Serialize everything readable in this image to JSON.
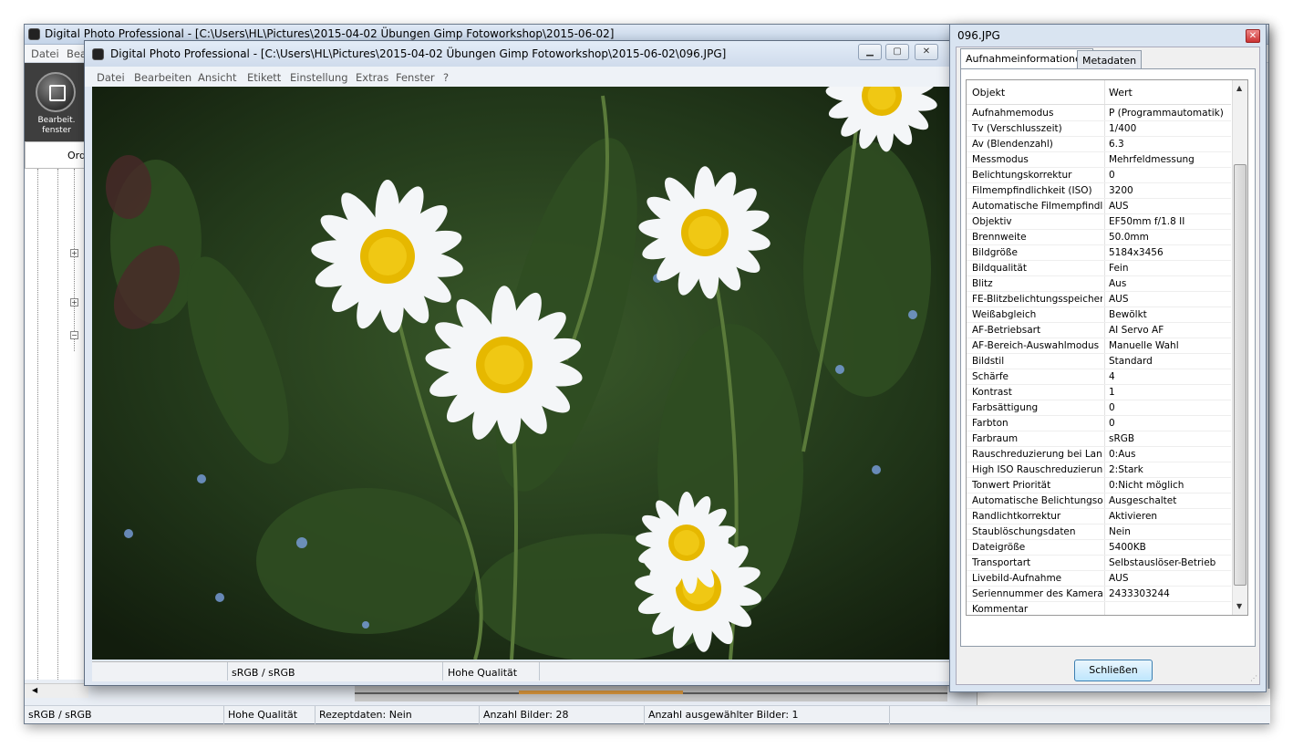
{
  "back_window": {
    "title": "Digital Photo Professional - [C:\\Users\\HL\\Pictures\\2015-04-02 Übungen  Gimp Fotoworkshop\\2015-06-02]",
    "menu": [
      "Datei",
      "Bea"
    ],
    "edit_button_label": "Bearbeit. fenster",
    "folder_header": "Ord",
    "status": {
      "color": "sRGB / sRGB",
      "quality": "Hohe Qualität",
      "recipe": "Rezeptdaten: Nein",
      "count": "Anzahl Bilder: 28",
      "selected": "Anzahl ausgewählter Bilder: 1"
    }
  },
  "front_window": {
    "title": "Digital Photo Professional - [C:\\Users\\HL\\Pictures\\2015-04-02 Übungen  Gimp Fotoworkshop\\2015-06-02\\096.JPG]",
    "menu": [
      "Datei",
      "Bearbeiten",
      "Ansicht",
      "Etikett",
      "Einstellung",
      "Extras",
      "Fenster",
      "?"
    ],
    "status": {
      "color": "sRGB / sRGB",
      "quality": "Hohe Qualität"
    }
  },
  "dialog": {
    "title": "096.JPG",
    "tabs": [
      "Aufnahmeinformationen",
      "Metadaten"
    ],
    "active_tab": 0,
    "columns": [
      "Objekt",
      "Wert"
    ],
    "rows": [
      [
        "Aufnahmemodus",
        "P (Programmautomatik)"
      ],
      [
        "Tv (Verschlusszeit)",
        "1/400"
      ],
      [
        "Av (Blendenzahl)",
        "6.3"
      ],
      [
        "Messmodus",
        "Mehrfeldmessung"
      ],
      [
        "Belichtungskorrektur",
        "0"
      ],
      [
        "Filmempfindlichkeit (ISO)",
        "3200"
      ],
      [
        "Automatische Filmempfindli...",
        "AUS"
      ],
      [
        "Objektiv",
        "EF50mm f/1.8 II"
      ],
      [
        "Brennweite",
        "50.0mm"
      ],
      [
        "Bildgröße",
        "5184x3456"
      ],
      [
        "Bildqualität",
        "Fein"
      ],
      [
        "Blitz",
        "Aus"
      ],
      [
        "FE-Blitzbelichtungsspeicher...",
        "AUS"
      ],
      [
        "Weißabgleich",
        "Bewölkt"
      ],
      [
        "AF-Betriebsart",
        "AI Servo AF"
      ],
      [
        "AF-Bereich-Auswahlmodus",
        "Manuelle  Wahl"
      ],
      [
        "Bildstil",
        "Standard"
      ],
      [
        "Schärfe",
        "4"
      ],
      [
        "Kontrast",
        "1"
      ],
      [
        "Farbsättigung",
        "0"
      ],
      [
        "Farbton",
        "0"
      ],
      [
        "Farbraum",
        "sRGB"
      ],
      [
        "Rauschreduzierung bei Lan...",
        "0:Aus"
      ],
      [
        "High ISO Rauschreduzierung",
        "2:Stark"
      ],
      [
        "Tonwert Priorität",
        "0:Nicht möglich"
      ],
      [
        "Automatische Belichtungso...",
        "Ausgeschaltet"
      ],
      [
        "Randlichtkorrektur",
        "Aktivieren"
      ],
      [
        "Staublöschungsdaten",
        "Nein"
      ],
      [
        "Dateigröße",
        "5400KB"
      ],
      [
        "Transportart",
        "Selbstauslöser-Betrieb"
      ],
      [
        "Livebild-Aufnahme",
        "AUS"
      ],
      [
        "Seriennummer des Kamera...",
        "2433303244"
      ],
      [
        "Kommentar",
        ""
      ]
    ],
    "close_button": "Schließen"
  },
  "colors": {
    "title_bar": "#c4d4e8",
    "dialog_bg": "#d9e4f1",
    "close_button_border": "#3c7fb1"
  }
}
